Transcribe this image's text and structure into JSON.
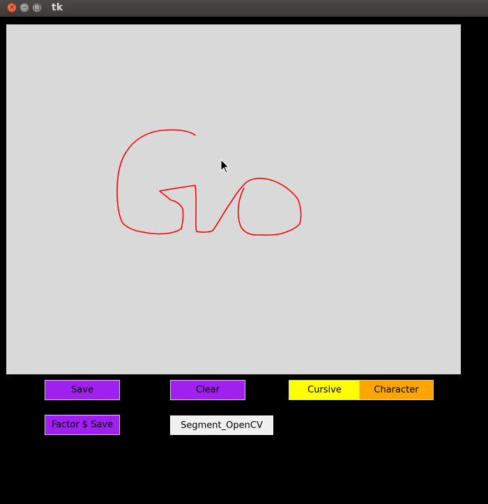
{
  "window": {
    "title": "tk",
    "close_glyph": "×",
    "minimize_glyph": "–",
    "maximize_glyph": "□"
  },
  "canvas": {
    "background": "#d9d9d9",
    "stroke_color": "#ff0000",
    "drawing_description_icon": "handwritten-strokes-icon"
  },
  "buttons": {
    "save": "Save",
    "clear": "Clear",
    "cursive": "Cursive",
    "character": "Character",
    "factor_save": "Factor $ Save",
    "segment": "Segment_OpenCV"
  },
  "colors": {
    "purple": "#a020f0",
    "yellow": "#ffff00",
    "orange": "#ffa500",
    "light": "#f0f0f0"
  }
}
